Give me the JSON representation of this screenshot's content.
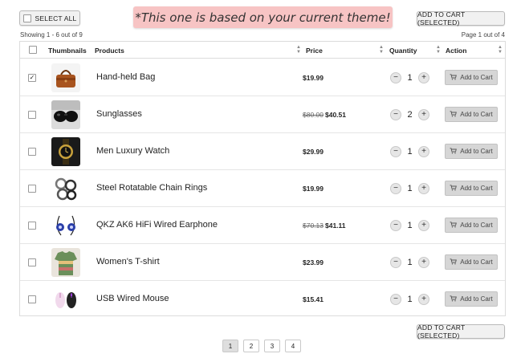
{
  "toolbar": {
    "select_all_label": "SELECT ALL",
    "add_selected_label": "ADD TO CART (SELECTED)",
    "theme_note": "*This one is based on your current theme!"
  },
  "summary": {
    "showing": "Showing 1 - 6 out of 9",
    "page_info": "Page 1 out of 4"
  },
  "columns": {
    "thumbnails": "Thumbnails",
    "products": "Products",
    "price": "Price",
    "quantity": "Quantity",
    "action": "Action"
  },
  "products": [
    {
      "name": "Hand-held Bag",
      "old_price": "",
      "price": "$19.99",
      "qty": "1",
      "checked": true,
      "action": "Add to Cart",
      "thumb": "bag"
    },
    {
      "name": "Sunglasses",
      "old_price": "$80.00",
      "price": "$40.51",
      "qty": "2",
      "checked": false,
      "action": "Add to Cart",
      "thumb": "sunglasses"
    },
    {
      "name": "Men Luxury Watch",
      "old_price": "",
      "price": "$29.99",
      "qty": "1",
      "checked": false,
      "action": "Add to Cart",
      "thumb": "watch"
    },
    {
      "name": "Steel Rotatable Chain Rings",
      "old_price": "",
      "price": "$19.99",
      "qty": "1",
      "checked": false,
      "action": "Add to Cart",
      "thumb": "rings"
    },
    {
      "name": "QKZ AK6 HiFi Wired Earphone",
      "old_price": "$70.13",
      "price": "$41.11",
      "qty": "1",
      "checked": false,
      "action": "Add to Cart",
      "thumb": "earphone"
    },
    {
      "name": "Women's T-shirt",
      "old_price": "",
      "price": "$23.99",
      "qty": "1",
      "checked": false,
      "action": "Add to Cart",
      "thumb": "tshirt"
    },
    {
      "name": "USB Wired Mouse",
      "old_price": "",
      "price": "$15.41",
      "qty": "1",
      "checked": false,
      "action": "Add to Cart",
      "thumb": "mouse"
    }
  ],
  "pagination": {
    "pages": [
      "1",
      "2",
      "3",
      "4"
    ],
    "active": "1"
  },
  "colors": {
    "theme_note_bg": "#f7c4c4",
    "action_button_bg": "#d6d6d6"
  }
}
